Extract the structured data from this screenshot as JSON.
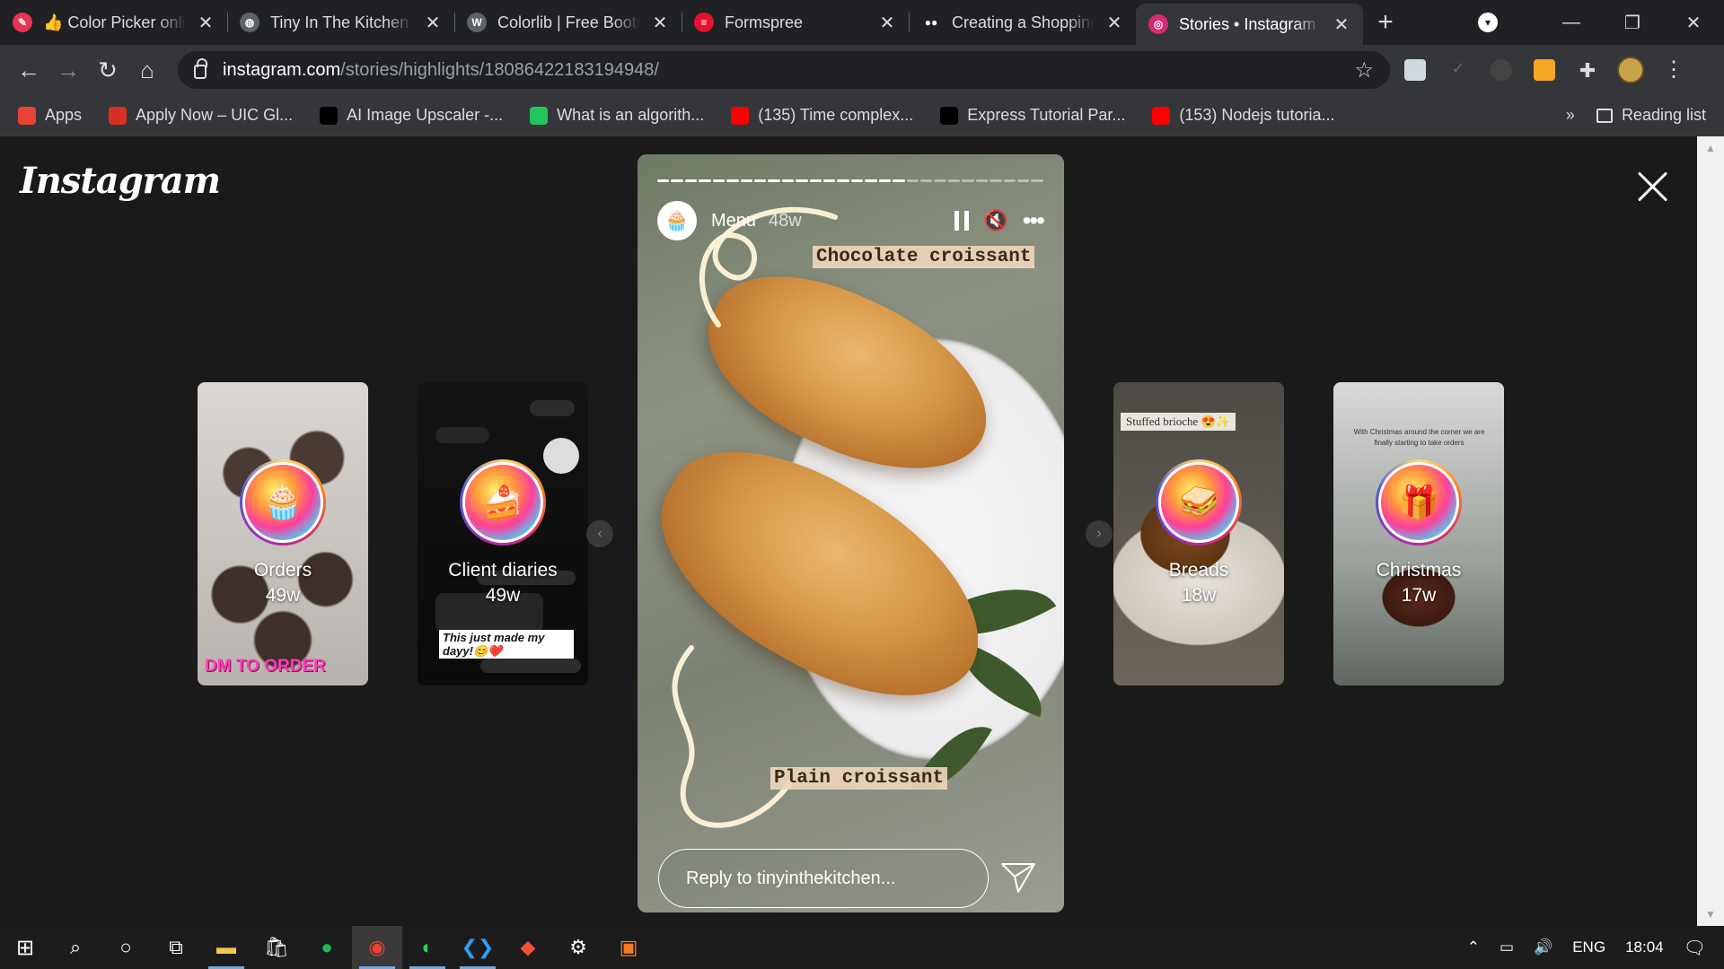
{
  "browser": {
    "tabs": [
      {
        "title": "👍 Color Picker online",
        "favicon_color": "#e8344e",
        "favicon_glyph": "✎"
      },
      {
        "title": "Tiny In The Kitchen",
        "favicon_color": "#5f6368",
        "favicon_glyph": "◍"
      },
      {
        "title": "Colorlib | Free Bootstrap",
        "favicon_color": "#5f6368",
        "favicon_glyph": "W"
      },
      {
        "title": "Formspree",
        "favicon_color": "#e5122e",
        "favicon_glyph": "≡"
      },
      {
        "title": "Creating a Shopping",
        "favicon_color": "#202124",
        "favicon_glyph": "●●"
      },
      {
        "title": "Stories • Instagram",
        "favicon_color": "#d62976",
        "favicon_glyph": "◎",
        "active": true
      }
    ],
    "new_tab": "+",
    "window_controls": {
      "minimize": "—",
      "restore": "❐",
      "close": "✕"
    },
    "url_host": "instagram.com",
    "url_path": "/stories/highlights/18086422183194948/",
    "bookmarks": [
      {
        "label": "Apps",
        "color": "#ea4335"
      },
      {
        "label": "Apply Now – UIC Gl...",
        "color": "#d93025"
      },
      {
        "label": "AI Image Upscaler -...",
        "color": "#000000"
      },
      {
        "label": "What is an algorith...",
        "color": "#22c55e"
      },
      {
        "label": "(135) Time complex...",
        "color": "#ff0000"
      },
      {
        "label": "Express Tutorial Par...",
        "color": "#000000"
      },
      {
        "label": "(153) Nodejs tutoria...",
        "color": "#ff0000"
      }
    ],
    "bookmarks_more": "»",
    "reading_list": "Reading list"
  },
  "instagram": {
    "logo": "Instagram",
    "highlights_left": [
      {
        "name": "Orders",
        "age": "49w",
        "overlay": "DM TO ORDER",
        "icon": "🧁"
      },
      {
        "name": "Client diaries",
        "age": "49w",
        "overlay": "This just made my dayy!😊❤️",
        "icon": "🍰"
      }
    ],
    "highlights_right": [
      {
        "name": "Breads",
        "age": "18w",
        "overlay": "Stuffed brioche 😍✨",
        "icon": "🥪"
      },
      {
        "name": "Christmas",
        "age": "17w",
        "overlay": "With Christmas around the corner we are finally starting to take orders",
        "icon": "🎁"
      }
    ],
    "story": {
      "title": "Menu",
      "age": "48w",
      "caption_top": "Chocolate croissant",
      "caption_bottom": "Plain croissant",
      "reply_placeholder": "Reply to tinyinthekitchen...",
      "progress_segments": 28,
      "progress_done": 18
    }
  },
  "taskbar": {
    "lang": "ENG",
    "time": "18:04"
  }
}
